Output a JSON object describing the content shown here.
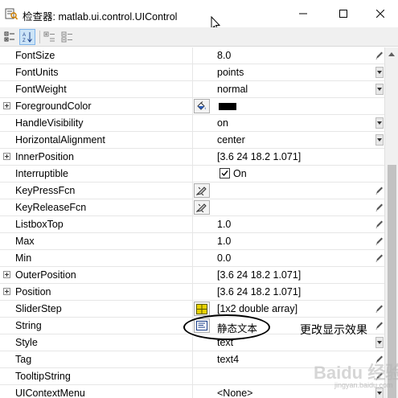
{
  "window": {
    "title": "检查器:  matlab.ui.control.UIControl",
    "minimize_icon": "minimize-icon",
    "maximize_icon": "maximize-icon",
    "close_icon": "close-icon"
  },
  "toolbar": {
    "buttons": [
      {
        "icon": "categorized-view-icon",
        "active": false
      },
      {
        "icon": "alphabetical-sort-icon",
        "active": true
      },
      {
        "icon": "expand-all-icon",
        "active": false
      },
      {
        "icon": "collapse-all-icon",
        "active": false
      }
    ]
  },
  "properties": [
    {
      "name": "FontSize",
      "value": "8.0",
      "editor": "pencil"
    },
    {
      "name": "FontUnits",
      "value": "points",
      "editor": "dropdown"
    },
    {
      "name": "FontWeight",
      "value": "normal",
      "editor": "dropdown"
    },
    {
      "name": "ForegroundColor",
      "value": "",
      "expandable": true,
      "color": "#000000",
      "cell_button": "paint-bucket-icon"
    },
    {
      "name": "HandleVisibility",
      "value": "on",
      "editor": "dropdown"
    },
    {
      "name": "HorizontalAlignment",
      "value": "center",
      "editor": "dropdown"
    },
    {
      "name": "InnerPosition",
      "value": "[3.6 24 18.2 1.071]",
      "expandable": true
    },
    {
      "name": "Interruptible",
      "value": "On",
      "checked": true
    },
    {
      "name": "KeyPressFcn",
      "value": "",
      "editor": "pencil",
      "cell_button": "callback-icon"
    },
    {
      "name": "KeyReleaseFcn",
      "value": "",
      "editor": "pencil",
      "cell_button": "callback-icon"
    },
    {
      "name": "ListboxTop",
      "value": "1.0",
      "editor": "pencil"
    },
    {
      "name": "Max",
      "value": "1.0",
      "editor": "pencil"
    },
    {
      "name": "Min",
      "value": "0.0",
      "editor": "pencil"
    },
    {
      "name": "OuterPosition",
      "value": "[3.6 24 18.2 1.071]",
      "expandable": true
    },
    {
      "name": "Position",
      "value": "[3.6 24 18.2 1.071]",
      "expandable": true
    },
    {
      "name": "SliderStep",
      "value": "[1x2  double array]",
      "editor": "pencil",
      "cell_button": "array-editor-icon"
    },
    {
      "name": "String",
      "value": "静态文本",
      "editor": "pencil",
      "cell_button": "string-editor-icon"
    },
    {
      "name": "Style",
      "value": "text",
      "editor": "dropdown"
    },
    {
      "name": "Tag",
      "value": "text4",
      "editor": "pencil"
    },
    {
      "name": "TooltipString",
      "value": "",
      "editor": "pencil"
    },
    {
      "name": "UIContextMenu",
      "value": "<None>",
      "editor": "dropdown"
    }
  ],
  "annotation": {
    "text": "更改显示效果"
  },
  "watermark": {
    "text": "Baidu 经验",
    "subtext": "jingyan.baidu.com"
  }
}
